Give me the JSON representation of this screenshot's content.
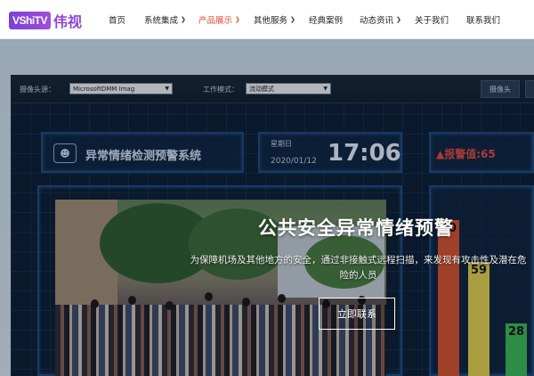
{
  "brand": {
    "logo_en": "VShiTV",
    "logo_cn": "伟视"
  },
  "nav": {
    "items": [
      {
        "label": "首页",
        "has_dropdown": false,
        "active": false
      },
      {
        "label": "系统集成",
        "has_dropdown": true,
        "active": false
      },
      {
        "label": "产品展示",
        "has_dropdown": true,
        "active": true
      },
      {
        "label": "其他服务",
        "has_dropdown": true,
        "active": false
      },
      {
        "label": "经典案例",
        "has_dropdown": false,
        "active": false
      },
      {
        "label": "动态资讯",
        "has_dropdown": true,
        "active": false
      },
      {
        "label": "关于我们",
        "has_dropdown": false,
        "active": false
      },
      {
        "label": "联系我们",
        "has_dropdown": false,
        "active": false
      }
    ],
    "active_color": "#e8472e"
  },
  "screen": {
    "camera_label": "摄像头源：",
    "camera_value": "MicrosoftDMM Imag",
    "mode_label": "工作模式：",
    "mode_value": "流动模式",
    "camera_button": "摄像头",
    "system_title": "异常情绪检测预警系统",
    "weekday": "星期日",
    "date": "2020/01/12",
    "time": "17:06",
    "alarm": "▲报警值:65",
    "bars": [
      {
        "value": "80",
        "color": "#d9512c",
        "level": 80
      },
      {
        "value": "59",
        "color": "#e8d24a",
        "level": 59
      },
      {
        "value": "28",
        "color": "#3cba54",
        "level": 28
      }
    ]
  },
  "hero": {
    "title": "公共安全异常情绪预警",
    "subtitle": "为保障机场及其他地方的安全，通过非接触式远程扫描，来发现有攻击性及潜在危险的人员",
    "cta": "立即联系"
  }
}
